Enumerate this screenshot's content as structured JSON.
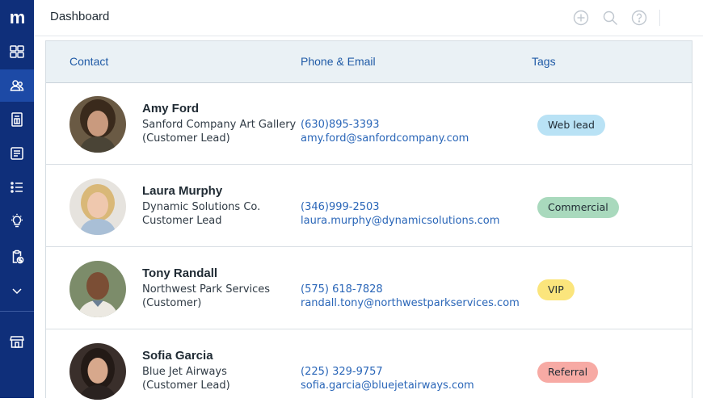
{
  "app": {
    "logo_text": "m"
  },
  "header": {
    "title": "Dashboard"
  },
  "sidebar": {
    "items": [
      {
        "icon": "dashboard-grid-icon",
        "active": false
      },
      {
        "icon": "contacts-icon",
        "active": true
      },
      {
        "icon": "invoice-icon",
        "active": false
      },
      {
        "icon": "notes-icon",
        "active": false
      },
      {
        "icon": "list-icon",
        "active": false
      },
      {
        "icon": "lightbulb-icon",
        "active": false
      },
      {
        "icon": "billing-clipboard-icon",
        "active": false
      },
      {
        "icon": "chevron-down-icon",
        "active": false
      },
      {
        "icon": "storefront-icon",
        "active": false
      }
    ]
  },
  "header_icons": [
    "add-circle-icon",
    "search-icon",
    "help-icon"
  ],
  "table": {
    "columns": [
      "Contact",
      "Phone & Email",
      "Tags"
    ],
    "rows": [
      {
        "name": "Amy Ford",
        "company": "Sanford Company Art Gallery",
        "status": "(Customer Lead)",
        "phone": "(630)895-3393",
        "email": "amy.ford@sanfordcompany.com",
        "tag": "Web lead",
        "tag_color": "#b9e2f5"
      },
      {
        "name": "Laura Murphy",
        "company": "Dynamic Solutions Co.",
        "status": "Customer Lead",
        "phone": "(346)999-2503",
        "email": "laura.murphy@dynamicsolutions.com",
        "tag": "Commercial",
        "tag_color": "#a9d9bd"
      },
      {
        "name": "Tony Randall",
        "company": "Northwest Park Services",
        "status": "(Customer)",
        "phone": "(575) 618-7828",
        "email": "randall.tony@northwestparkservices.com",
        "tag": "VIP",
        "tag_color": "#fbe57c"
      },
      {
        "name": "Sofia Garcia",
        "company": "Blue Jet Airways",
        "status": "(Customer Lead)",
        "phone": "(225) 329-9757",
        "email": "sofia.garcia@bluejetairways.com",
        "tag": "Referral",
        "tag_color": "#f7aaa4"
      }
    ]
  }
}
